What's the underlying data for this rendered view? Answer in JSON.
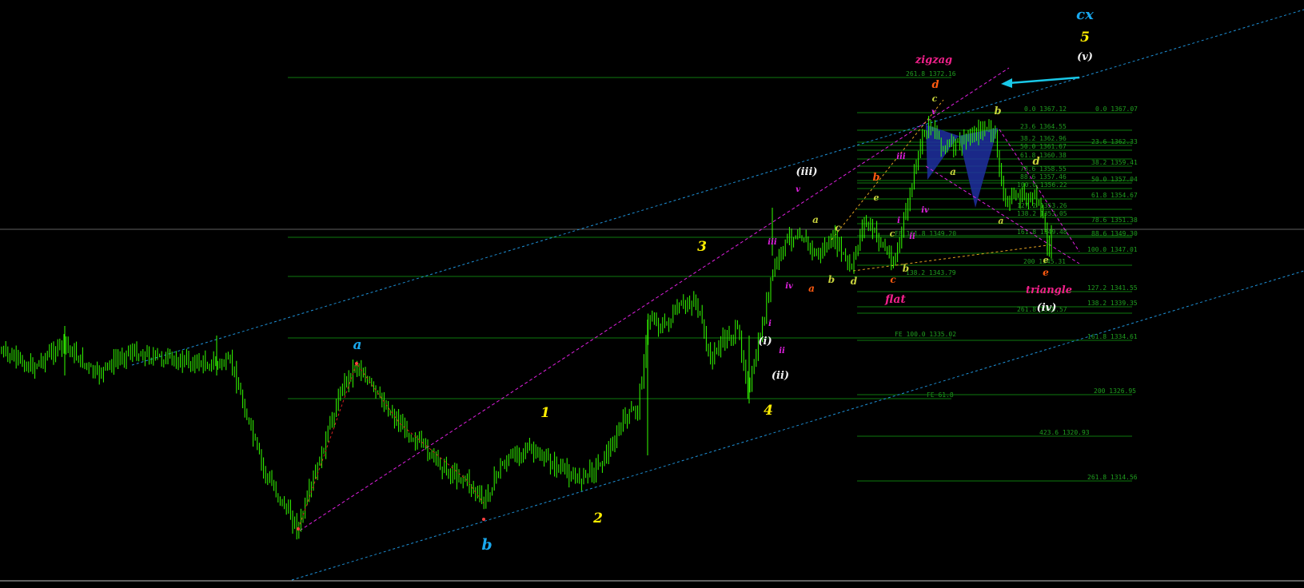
{
  "chart_data": {
    "type": "candlestick",
    "colors": {
      "background": "#000000",
      "candle": "#33ff00",
      "level_line": "#0e7a0e",
      "level_label": "#1f9f1f",
      "channel": "#1e90d6",
      "trendline": "#e020e0",
      "zigzag": "#d02020",
      "wave_yellow": "#ffee00",
      "wave_cyan": "#19a8ee",
      "wave_white": "#f2f2f2",
      "wave_pink": "#f0208a",
      "wave_orange": "#ff5a10",
      "wave_olive": "#c8d23c",
      "wave_magenta": "#e020e0",
      "pattern_fill": "#1e2fa0",
      "arrow": "#19c8e8"
    },
    "levels": [
      {
        "label": "261.8 1372.16",
        "price": 1372.16
      },
      {
        "label": "0.0 1367.12",
        "price": 1367.12
      },
      {
        "label": "0.0 1367.07",
        "price": 1367.07
      },
      {
        "label": "23.6 1364.55",
        "price": 1364.55
      },
      {
        "label": "38.2 1362.96",
        "price": 1362.96
      },
      {
        "label": "23.6 1362.33",
        "price": 1362.33
      },
      {
        "label": "50.0 1361.67",
        "price": 1361.67
      },
      {
        "label": "61.8 1360.38",
        "price": 1360.38
      },
      {
        "label": "38.2 1359.41",
        "price": 1359.41
      },
      {
        "label": "78.6 1358.55",
        "price": 1358.55
      },
      {
        "label": "88.6 1357.46",
        "price": 1357.46
      },
      {
        "label": "50.0 1357.04",
        "price": 1357.04
      },
      {
        "label": "100.0 1356.22",
        "price": 1356.22
      },
      {
        "label": "61.8 1354.67",
        "price": 1354.67
      },
      {
        "label": "127.2 1353.26",
        "price": 1353.26
      },
      {
        "label": "138.2 1353.05",
        "price": 1353.05
      },
      {
        "label": "78.6 1351.38",
        "price": 1351.38
      },
      {
        "label": "FE 161.8 1349.20",
        "price": 1349.2
      },
      {
        "label": "161.8 1349.48",
        "price": 1349.48
      },
      {
        "label": "88.6 1349.30",
        "price": 1349.3
      },
      {
        "label": "100.0 1347.01",
        "price": 1347.01
      },
      {
        "label": "200 1345.31",
        "price": 1345.31
      },
      {
        "label": "138.2 1343.79",
        "price": 1343.79
      },
      {
        "label": "127.2 1341.55",
        "price": 1341.55
      },
      {
        "label": "138.2 1339.35",
        "price": 1339.35
      },
      {
        "label": "261.8 1338.57",
        "price": 1338.57
      },
      {
        "label": "FE 100.0 1335.02",
        "price": 1335.02
      },
      {
        "label": "161.8 1334.61",
        "price": 1334.61
      },
      {
        "label": "FE 61.8",
        "price": 1327.0
      },
      {
        "label": "200 1326.95",
        "price": 1326.95
      },
      {
        "label": "423.6 1320.93",
        "price": 1320.93
      },
      {
        "label": "261.8 1314.56",
        "price": 1314.56
      }
    ],
    "wave_labels": [
      {
        "text": "cx",
        "color": "wave_cyan",
        "size": 18
      },
      {
        "text": "5",
        "color": "wave_yellow",
        "size": 17
      },
      {
        "text": "(v)",
        "color": "wave_white",
        "size": 13
      },
      {
        "text": "zigzag",
        "color": "wave_pink",
        "size": 13
      },
      {
        "text": "d",
        "color": "wave_orange",
        "size": 13
      },
      {
        "text": "c",
        "color": "wave_olive",
        "size": 11
      },
      {
        "text": "v",
        "color": "wave_magenta",
        "size": 10
      },
      {
        "text": "b",
        "color": "wave_olive",
        "size": 13
      },
      {
        "text": "iii",
        "color": "wave_magenta",
        "size": 10
      },
      {
        "text": "b",
        "color": "wave_orange",
        "size": 13
      },
      {
        "text": "e",
        "color": "wave_olive",
        "size": 11
      },
      {
        "text": "a",
        "color": "wave_olive",
        "size": 12
      },
      {
        "text": "d",
        "color": "wave_olive",
        "size": 13
      },
      {
        "text": "(iii)",
        "color": "wave_white",
        "size": 13
      },
      {
        "text": "v",
        "color": "wave_magenta",
        "size": 10
      },
      {
        "text": "a",
        "color": "wave_olive",
        "size": 12
      },
      {
        "text": "c",
        "color": "wave_olive",
        "size": 12
      },
      {
        "text": "iv",
        "color": "wave_magenta",
        "size": 10
      },
      {
        "text": "i",
        "color": "wave_magenta",
        "size": 10
      },
      {
        "text": "ii",
        "color": "wave_magenta",
        "size": 10
      },
      {
        "text": "a",
        "color": "wave_olive",
        "size": 11
      },
      {
        "text": "c",
        "color": "wave_olive",
        "size": 11
      },
      {
        "text": "3",
        "color": "wave_yellow",
        "size": 17
      },
      {
        "text": "iii",
        "color": "wave_magenta",
        "size": 10
      },
      {
        "text": "b",
        "color": "wave_olive",
        "size": 12
      },
      {
        "text": "b",
        "color": "wave_olive",
        "size": 12
      },
      {
        "text": "iv",
        "color": "wave_magenta",
        "size": 10
      },
      {
        "text": "a",
        "color": "wave_orange",
        "size": 12
      },
      {
        "text": "d",
        "color": "wave_olive",
        "size": 12
      },
      {
        "text": "c",
        "color": "wave_orange",
        "size": 12
      },
      {
        "text": "flat",
        "color": "wave_pink",
        "size": 14
      },
      {
        "text": "e",
        "color": "wave_olive",
        "size": 11
      },
      {
        "text": "e",
        "color": "wave_orange",
        "size": 12
      },
      {
        "text": "triangle",
        "color": "wave_pink",
        "size": 13
      },
      {
        "text": "(iv)",
        "color": "wave_white",
        "size": 13
      },
      {
        "text": "a",
        "color": "wave_cyan",
        "size": 17
      },
      {
        "text": "i",
        "color": "wave_magenta",
        "size": 10
      },
      {
        "text": "(i)",
        "color": "wave_white",
        "size": 13
      },
      {
        "text": "ii",
        "color": "wave_magenta",
        "size": 10
      },
      {
        "text": "(ii)",
        "color": "wave_white",
        "size": 13
      },
      {
        "text": "4",
        "color": "wave_yellow",
        "size": 17
      },
      {
        "text": "1",
        "color": "wave_yellow",
        "size": 17
      },
      {
        "text": "2",
        "color": "wave_yellow",
        "size": 17
      },
      {
        "text": "b",
        "color": "wave_cyan",
        "size": 19
      }
    ]
  }
}
